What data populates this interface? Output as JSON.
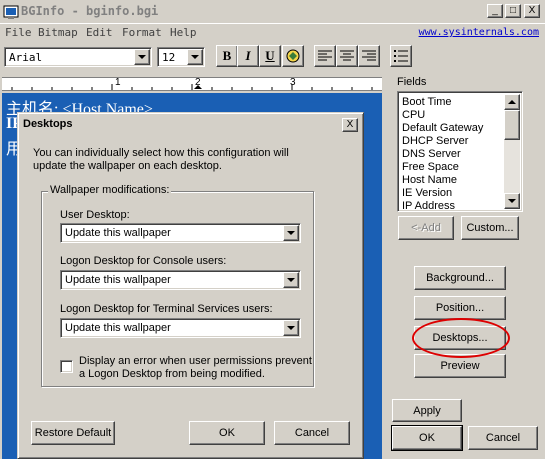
{
  "window": {
    "title": "BGInfo - bginfo.bgi",
    "min": "_",
    "max": "□",
    "close": "X"
  },
  "menu": [
    "File",
    "Bitmap",
    "Edit",
    "Format",
    "Help"
  ],
  "link": "www.sysinternals.com",
  "toolbar": {
    "font": "Arial",
    "size": "12",
    "bold": "B",
    "italic": "I",
    "underline": "U"
  },
  "ruler": {
    "marks": [
      "1",
      "2",
      "3"
    ]
  },
  "editor": {
    "lines": [
      "主机名: <Host Name>",
      "IP",
      "用"
    ]
  },
  "fields": {
    "label": "Fields",
    "items": [
      "Boot Time",
      "CPU",
      "Default Gateway",
      "DHCP Server",
      "DNS Server",
      "Free Space",
      "Host Name",
      "IE Version",
      "IP Address"
    ],
    "add": "<-Add",
    "custom": "Custom..."
  },
  "side_buttons": {
    "background": "Background...",
    "position": "Position...",
    "desktops": "Desktops...",
    "preview": "Preview"
  },
  "bottom_buttons": {
    "apply": "Apply",
    "ok": "OK",
    "cancel": "Cancel"
  },
  "dialog": {
    "title": "Desktops",
    "close": "X",
    "intro_line1": "You can individually select how this configuration will",
    "intro_line2": "update the wallpaper on each desktop.",
    "group_label": "Wallpaper modifications:",
    "user_label": "User Desktop:",
    "user_value": "Update this wallpaper",
    "console_label": "Logon Desktop for Console users:",
    "console_value": "Update this wallpaper",
    "ts_label": "Logon Desktop for Terminal Services users:",
    "ts_value": "Update this wallpaper",
    "check_line1": "Display an error when user permissions prevent",
    "check_line2": "a Logon Desktop from being modified.",
    "restore": "Restore Default",
    "ok": "OK",
    "cancel": "Cancel"
  },
  "colors": {
    "editor_bg": "#1a5fb4",
    "annotation": "#dd0000"
  }
}
